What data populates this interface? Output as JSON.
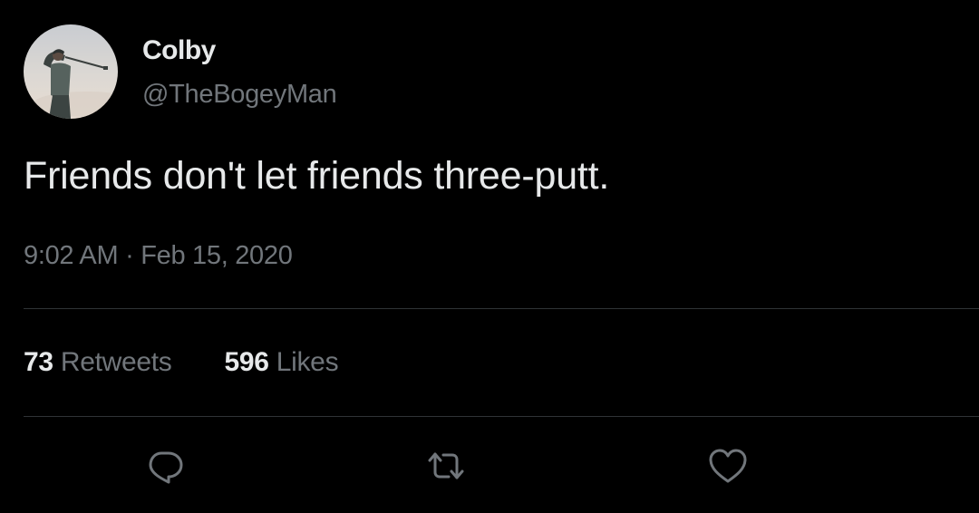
{
  "tweet": {
    "author": {
      "display_name": "Colby",
      "handle": "@TheBogeyMan"
    },
    "text": "Friends don't let friends three-putt.",
    "time": "9:02 AM",
    "separator": "·",
    "date": "Feb 15, 2020",
    "stats": {
      "retweets_count": "73",
      "retweets_label": "Retweets",
      "likes_count": "596",
      "likes_label": "Likes"
    }
  },
  "theme": {
    "background": "#000000",
    "primary_text": "#e7e9ea",
    "secondary_text": "#71767b",
    "divider": "#2f3336"
  },
  "icons": {
    "reply": "speech-bubble-outline",
    "retweet": "retweet-arrows",
    "like": "heart-outline"
  }
}
